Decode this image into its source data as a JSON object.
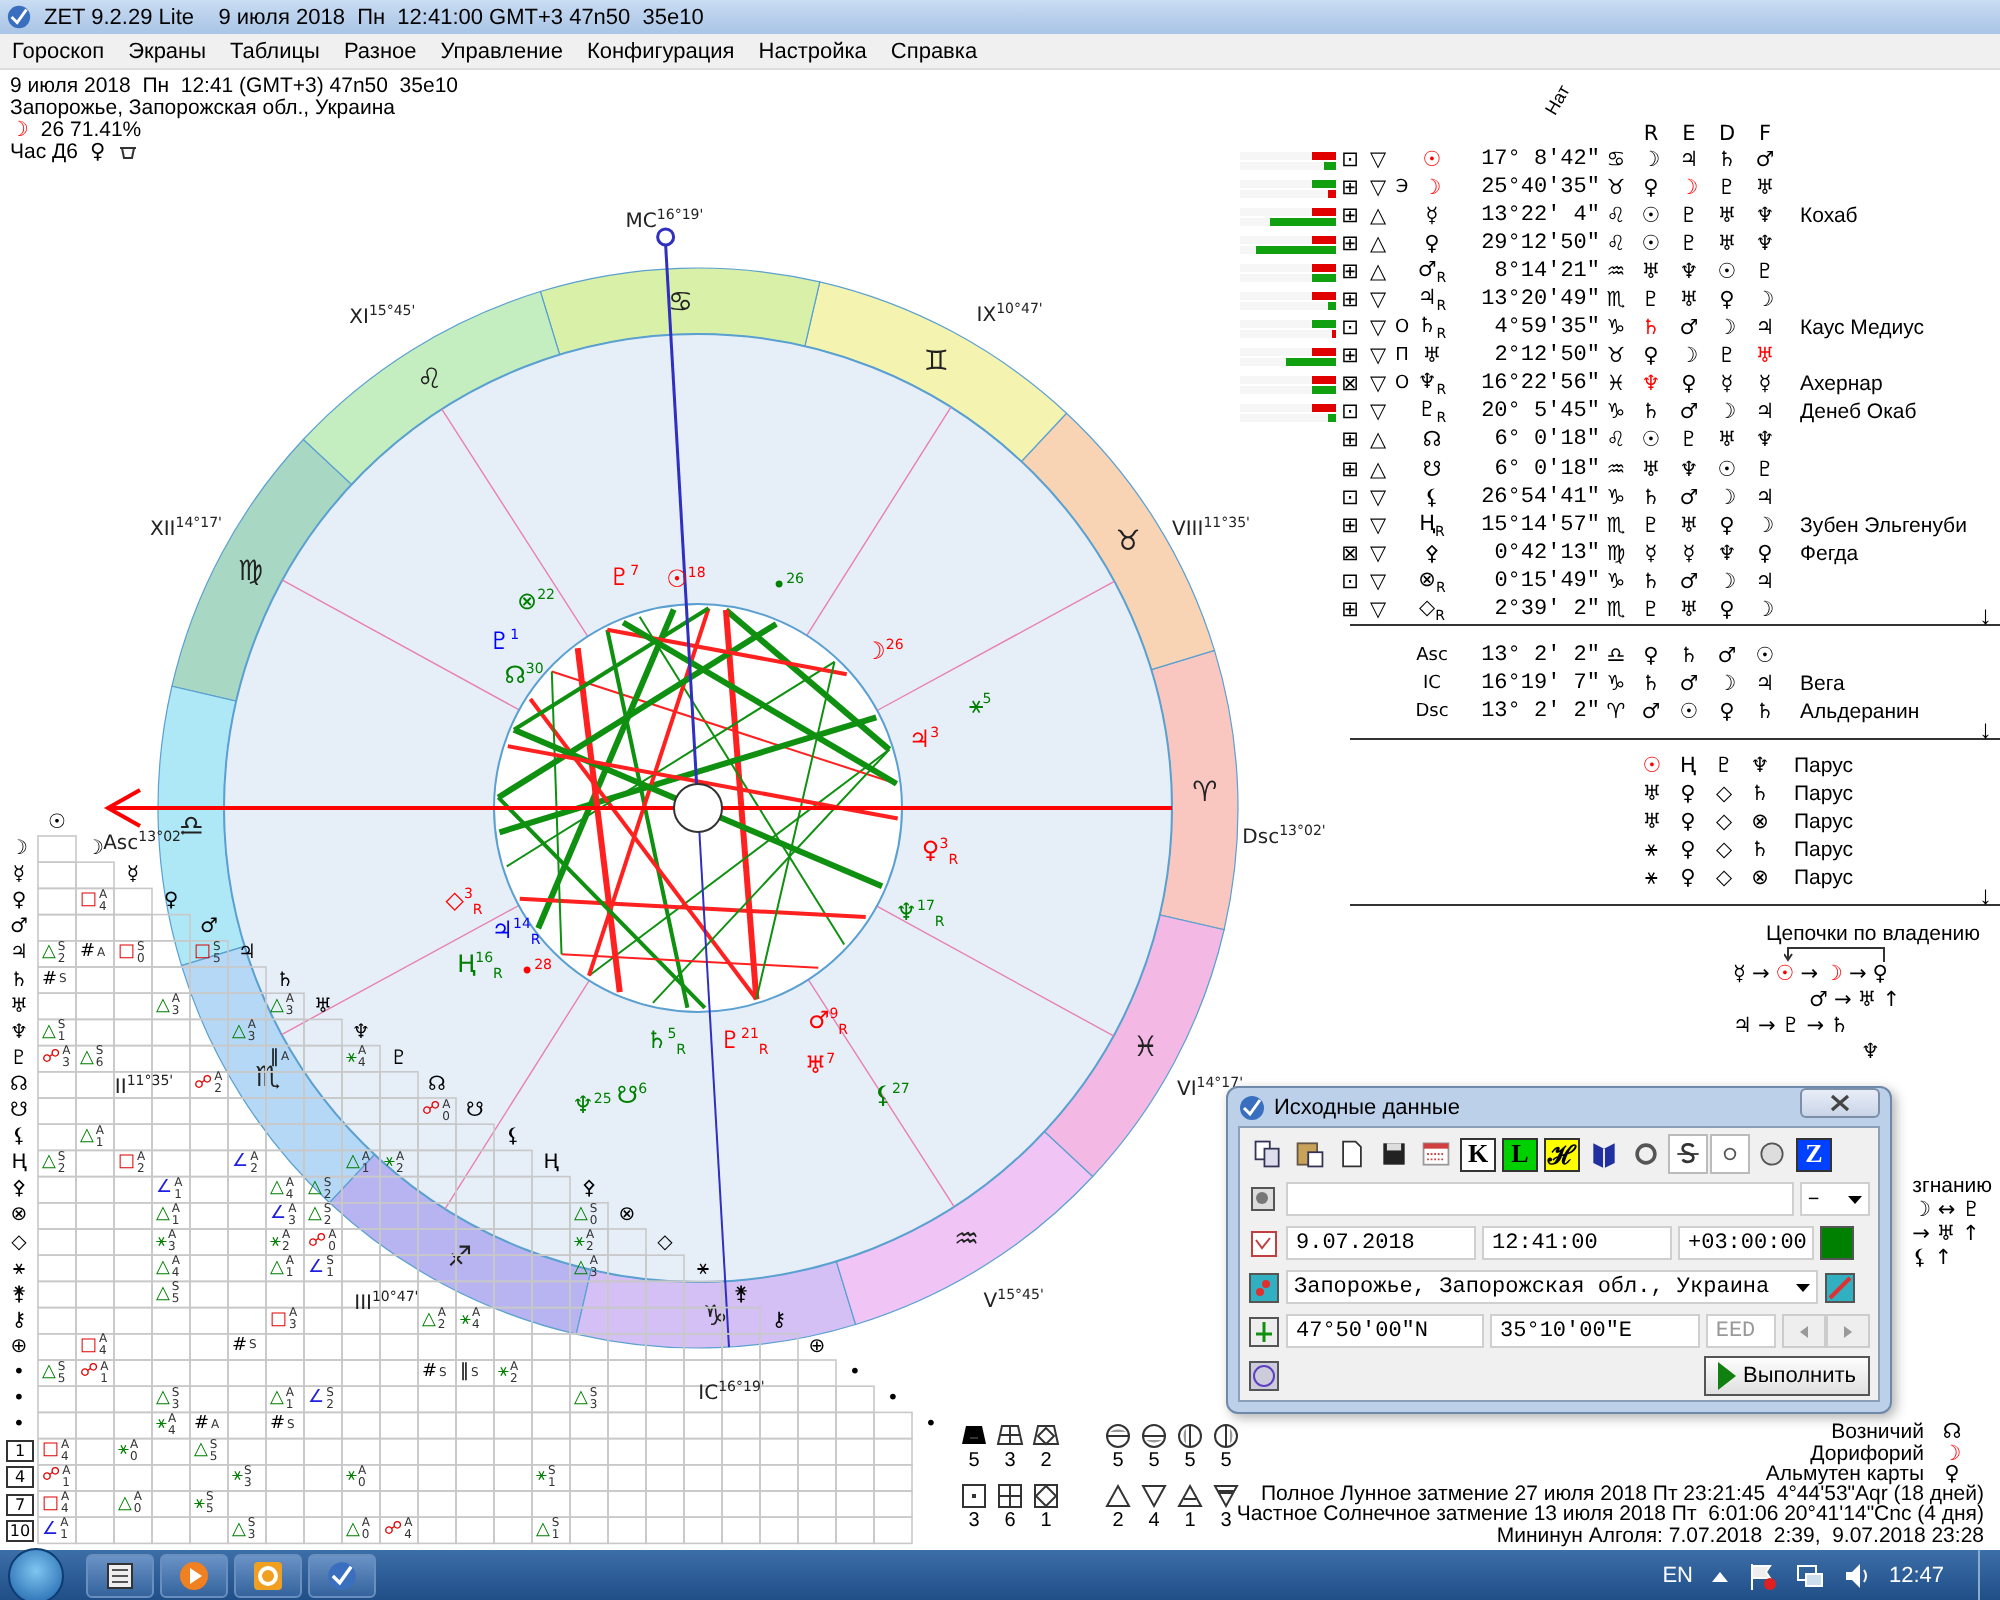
{
  "window": {
    "title": "ZET 9.2.29 Lite    9 июля 2018  Пн  12:41:00 GMT+3 47n50  35e10"
  },
  "menu": [
    "Гороскоп",
    "Экраны",
    "Таблицы",
    "Разное",
    "Управление",
    "Конфигурация",
    "Настройка",
    "Справка"
  ],
  "info": {
    "line1": "9 июля 2018  Пн  12:41 (GMT+3) 47n50  35e10",
    "place": "Запорожье, Запорожская обл., Украина",
    "moon_glyph": "☽",
    "moon": "26 71.41%",
    "hour": "Час Д6",
    "hour_glyph": "♀"
  },
  "wheel": {
    "signs": [
      "♈",
      "♉",
      "♊",
      "♋",
      "♌",
      "♍",
      "♎",
      "♏",
      "♐",
      "♑",
      "♒",
      "♓"
    ],
    "houses": [
      {
        "label": "Asc$^{13°02'}$"
      },
      {
        "label": "II$^{11°35'}$"
      },
      {
        "label": "III$^{10°47'}$"
      },
      {
        "label": "IC$^{16°19'}$"
      },
      {
        "label": "V$^{15°45'}$"
      },
      {
        "label": "VI$^{14°17'}$"
      },
      {
        "label": "Dsc$^{13°02'}$"
      },
      {
        "label": "VIII$^{11°35'}$"
      },
      {
        "label": "IX$^{10°47'}$"
      },
      {
        "label": "MC$^{16°19'}$"
      },
      {
        "label": "XI$^{15°45'}$"
      },
      {
        "label": "XII$^{14°17'}$"
      }
    ],
    "planets": [
      {
        "label": "☉$^{18}$",
        "color": "#ff0000"
      },
      {
        "label": "•$^{26}$",
        "color": "#008000"
      },
      {
        "label": "☽$^{26}$",
        "color": "#ff0000"
      },
      {
        "label": "⚹$^{5}$",
        "color": "#008000"
      },
      {
        "label": "♃$^{3}$",
        "color": "#ff0000"
      },
      {
        "label": "♀$^{3}$$_{R}$",
        "color": "#ff0000"
      },
      {
        "label": "♆$^{17}$$_{R}$",
        "color": "#008000"
      },
      {
        "label": "♂$^{9}$$_{R}$",
        "color": "#ff0000"
      },
      {
        "label": "♅$^{7}$",
        "color": "#ff0000"
      },
      {
        "label": "⚸$^{27}$",
        "color": "#008000"
      },
      {
        "label": "♄$^{5}$$_{R}$",
        "color": "#008000"
      },
      {
        "label": "♇$^{21}$$_{R}$",
        "color": "#ff0000"
      },
      {
        "label": "☋$^{6}$",
        "color": "#008000"
      },
      {
        "label": "♆$^{25}$",
        "color": "#008000"
      },
      {
        "label": "◇$^{3}$$_{R}$",
        "color": "#ff0000"
      },
      {
        "label": "♃$^{14}$$_{R}$",
        "color": "#0000ff"
      },
      {
        "label": "Ⱨ$^{16}$$_{R}$",
        "color": "#008000"
      },
      {
        "label": "•$^{28}$",
        "color": "#ff0000"
      },
      {
        "label": "♇$^{1}$",
        "color": "#0000ff"
      },
      {
        "label": "⊗$^{22}$",
        "color": "#008000"
      },
      {
        "label": "♇$^{7}$",
        "color": "#ff0000"
      },
      {
        "label": "☊$^{30}$",
        "color": "#008000"
      }
    ]
  },
  "aspect_grid": {
    "col_headers": [
      "☉",
      "☽",
      "☿",
      "♀",
      "♂",
      "♃",
      "♄",
      "♅",
      "♆",
      "♇",
      "☊",
      "☋",
      "⚸",
      "Ⱨ",
      "⚴",
      "⊗",
      "◇",
      "⚹",
      "⚵",
      "⚷",
      "⊕",
      "•",
      "•",
      "•"
    ],
    "rows": [
      {
        "label": "☽",
        "kind": "planet",
        "cells": []
      },
      {
        "label": "☿",
        "kind": "planet",
        "cells": []
      },
      {
        "label": "♀",
        "kind": "planet",
        "cells": [
          null,
          {
            "a": "□",
            "n": "A4",
            "kind": "square"
          }
        ]
      },
      {
        "label": "♂",
        "kind": "planet",
        "cells": []
      },
      {
        "label": "♃",
        "kind": "planet",
        "cells": [
          {
            "a": "△",
            "n": "S2",
            "kind": "trine"
          },
          {
            "a": "#",
            "n": "A",
            "kind": "parallel"
          },
          {
            "a": "□",
            "n": "S0",
            "kind": "square"
          },
          null,
          {
            "a": "□",
            "n": "S5",
            "kind": "square"
          }
        ]
      },
      {
        "label": "♄",
        "kind": "planet",
        "cells": [
          {
            "a": "#",
            "n": "S",
            "kind": "parallel"
          }
        ]
      },
      {
        "label": "♅",
        "kind": "planet",
        "cells": [
          null,
          null,
          null,
          {
            "a": "△",
            "n": "A3",
            "kind": "trine"
          },
          null,
          null,
          {
            "a": "△",
            "n": "A3",
            "kind": "trine"
          }
        ]
      },
      {
        "label": "♆",
        "kind": "planet",
        "cells": [
          {
            "a": "△",
            "n": "S1",
            "kind": "trine"
          },
          null,
          null,
          null,
          null,
          {
            "a": "△",
            "n": "A3",
            "kind": "trine"
          }
        ]
      },
      {
        "label": "♇",
        "kind": "planet",
        "cells": [
          {
            "a": "☍",
            "n": "A3",
            "kind": "opposition"
          },
          {
            "a": "△",
            "n": "S6",
            "kind": "trine"
          },
          null,
          null,
          null,
          null,
          {
            "a": "‖",
            "n": "A",
            "kind": "parallel"
          },
          null,
          {
            "a": "⚹",
            "n": "A4",
            "kind": "sextile"
          }
        ]
      },
      {
        "label": "☊",
        "kind": "planet",
        "cells": [
          null,
          null,
          null,
          null,
          {
            "a": "☍",
            "n": "A2",
            "kind": "opposition"
          }
        ]
      },
      {
        "label": "☋",
        "kind": "planet",
        "cells": [
          null,
          null,
          null,
          null,
          null,
          null,
          null,
          null,
          null,
          null,
          {
            "a": "☍",
            "n": "A0",
            "kind": "opposition"
          }
        ]
      },
      {
        "label": "⚸",
        "kind": "planet",
        "cells": [
          null,
          {
            "a": "△",
            "n": "A1",
            "kind": "trine"
          }
        ]
      },
      {
        "label": "Ⱨ",
        "kind": "planet",
        "cells": [
          {
            "a": "△",
            "n": "S2",
            "kind": "trine"
          },
          null,
          {
            "a": "□",
            "n": "A2",
            "kind": "square"
          },
          null,
          null,
          {
            "a": "∠",
            "n": "A2",
            "kind": "minor"
          },
          null,
          null,
          {
            "a": "△",
            "n": "A1",
            "kind": "trine"
          },
          {
            "a": "⚹",
            "n": "A2",
            "kind": "sextile"
          }
        ]
      },
      {
        "label": "⚴",
        "kind": "planet",
        "cells": [
          null,
          null,
          null,
          {
            "a": "∠",
            "n": "A1",
            "kind": "minor"
          },
          null,
          null,
          {
            "a": "△",
            "n": "A4",
            "kind": "trine"
          },
          {
            "a": "△",
            "n": "S2",
            "kind": "trine"
          }
        ]
      },
      {
        "label": "⊗",
        "kind": "planet",
        "cells": [
          null,
          null,
          null,
          {
            "a": "△",
            "n": "A1",
            "kind": "trine"
          },
          null,
          null,
          {
            "a": "∠",
            "n": "A3",
            "kind": "minor"
          },
          {
            "a": "△",
            "n": "S2",
            "kind": "trine"
          },
          null,
          null,
          null,
          null,
          null,
          null,
          {
            "a": "△",
            "n": "S0",
            "kind": "trine"
          }
        ]
      },
      {
        "label": "◇",
        "kind": "planet",
        "cells": [
          null,
          null,
          null,
          {
            "a": "⚹",
            "n": "A3",
            "kind": "sextile"
          },
          null,
          null,
          {
            "a": "⚹",
            "n": "A2",
            "kind": "sextile"
          },
          {
            "a": "☍",
            "n": "A0",
            "kind": "opposition"
          },
          null,
          null,
          null,
          null,
          null,
          null,
          {
            "a": "⚹",
            "n": "A2",
            "kind": "sextile"
          }
        ]
      },
      {
        "label": "⚹",
        "kind": "planet",
        "cells": [
          null,
          null,
          null,
          {
            "a": "△",
            "n": "A4",
            "kind": "trine"
          },
          null,
          null,
          {
            "a": "△",
            "n": "A1",
            "kind": "trine"
          },
          {
            "a": "∠",
            "n": "S1",
            "kind": "minor"
          },
          null,
          null,
          null,
          null,
          null,
          null,
          {
            "a": "△",
            "n": "A3",
            "kind": "trine"
          }
        ]
      },
      {
        "label": "⚵",
        "kind": "planet",
        "cells": [
          null,
          null,
          null,
          {
            "a": "△",
            "n": "S5",
            "kind": "trine"
          }
        ]
      },
      {
        "label": "⚷",
        "kind": "planet",
        "cells": [
          null,
          null,
          null,
          null,
          null,
          null,
          {
            "a": "□",
            "n": "A3",
            "kind": "square"
          },
          null,
          null,
          null,
          {
            "a": "△",
            "n": "A2",
            "kind": "trine"
          },
          {
            "a": "⚹",
            "n": "A4",
            "kind": "sextile"
          }
        ]
      },
      {
        "label": "⊕",
        "kind": "planet",
        "cells": [
          null,
          {
            "a": "□",
            "n": "A4",
            "kind": "square"
          },
          null,
          null,
          null,
          {
            "a": "#",
            "n": "S",
            "kind": "parallel"
          }
        ]
      },
      {
        "label": "•",
        "kind": "planet",
        "cells": [
          {
            "a": "△",
            "n": "S5",
            "kind": "trine"
          },
          {
            "a": "☍",
            "n": "A1",
            "kind": "opposition"
          },
          null,
          null,
          null,
          null,
          null,
          null,
          null,
          null,
          {
            "a": "#",
            "n": "S",
            "kind": "parallel"
          },
          {
            "a": "‖",
            "n": "S",
            "kind": "parallel"
          },
          {
            "a": "⚹",
            "n": "A2",
            "kind": "sextile"
          }
        ]
      },
      {
        "label": "•",
        "kind": "planet",
        "cells": [
          null,
          null,
          null,
          {
            "a": "△",
            "n": "S3",
            "kind": "trine"
          },
          null,
          null,
          {
            "a": "△",
            "n": "A1",
            "kind": "trine"
          },
          {
            "a": "∠",
            "n": "S2",
            "kind": "minor"
          },
          null,
          null,
          null,
          null,
          null,
          null,
          {
            "a": "△",
            "n": "S3",
            "kind": "trine"
          }
        ]
      },
      {
        "label": "•",
        "kind": "planet",
        "cells": [
          null,
          null,
          null,
          {
            "a": "⚹",
            "n": "A4",
            "kind": "sextile"
          },
          {
            "a": "#",
            "n": "A",
            "kind": "parallel"
          },
          null,
          {
            "a": "#",
            "n": "S",
            "kind": "parallel"
          }
        ]
      },
      {
        "label": "1",
        "kind": "house",
        "cells": [
          {
            "a": "□",
            "n": "A4",
            "kind": "square"
          },
          null,
          {
            "a": "⚹",
            "n": "A0",
            "kind": "sextile"
          },
          null,
          {
            "a": "△",
            "n": "S5",
            "kind": "trine"
          }
        ]
      },
      {
        "label": "4",
        "kind": "house",
        "cells": [
          {
            "a": "☍",
            "n": "A1",
            "kind": "opposition"
          },
          null,
          null,
          null,
          null,
          {
            "a": "⚹",
            "n": "S3",
            "kind": "sextile"
          },
          null,
          null,
          {
            "a": "⚹",
            "n": "A0",
            "kind": "sextile"
          },
          null,
          null,
          null,
          null,
          {
            "a": "⚹",
            "n": "S1",
            "kind": "sextile"
          }
        ]
      },
      {
        "label": "7",
        "kind": "house",
        "cells": [
          {
            "a": "□",
            "n": "A4",
            "kind": "square"
          },
          null,
          {
            "a": "△",
            "n": "A0",
            "kind": "trine"
          },
          null,
          {
            "a": "⚹",
            "n": "S5",
            "kind": "sextile"
          }
        ]
      },
      {
        "label": "10",
        "kind": "house",
        "cells": [
          {
            "a": "∠",
            "n": "A1",
            "kind": "minor"
          },
          null,
          null,
          null,
          null,
          {
            "a": "△",
            "n": "S3",
            "kind": "trine"
          },
          null,
          null,
          {
            "a": "△",
            "n": "A0",
            "kind": "trine"
          },
          {
            "a": "☍",
            "n": "A4",
            "kind": "opposition"
          },
          null,
          null,
          null,
          {
            "a": "△",
            "n": "S1",
            "kind": "trine"
          }
        ]
      }
    ]
  },
  "stats": {
    "top_left": [
      {
        "kind": "cup",
        "value": "5"
      },
      {
        "kind": "crosscup",
        "value": "3"
      },
      {
        "kind": "diamondcup",
        "value": "2"
      }
    ],
    "bottom_left": [
      {
        "kind": "dotbox",
        "value": "3"
      },
      {
        "kind": "crossbox",
        "value": "6"
      },
      {
        "kind": "diamondbox",
        "value": "1"
      }
    ],
    "top_right": [
      {
        "kind": "circleup",
        "value": "5"
      },
      {
        "kind": "circledown",
        "value": "5"
      },
      {
        "kind": "circleleft",
        "value": "5"
      },
      {
        "kind": "circleright",
        "value": "5"
      }
    ],
    "bottom_right": [
      {
        "kind": "triup",
        "value": "2"
      },
      {
        "kind": "tridown",
        "value": "4"
      },
      {
        "kind": "triupbar",
        "value": "1"
      },
      {
        "kind": "tridownfilled",
        "value": "3"
      }
    ]
  },
  "table": {
    "header": "Нат",
    "columns": [
      "R",
      "E",
      "D",
      "F"
    ],
    "more": "↓",
    "rows": [
      {
        "bars": [
          {
            "color": "#e00000",
            "level": 0.25
          },
          {
            "color": "#10a010",
            "level": 0.125
          }
        ],
        "box": "⊡",
        "tri": "▽",
        "planet": "☉",
        "highlighted": true,
        "pos": "17° 8'42\"",
        "sign": "♋",
        "rulers": [
          {
            "g": "☽",
            "highlighted": false
          },
          {
            "g": "♃",
            "highlighted": false
          },
          {
            "g": "♄",
            "highlighted": false
          },
          {
            "g": "♂",
            "highlighted": false
          }
        ]
      },
      {
        "bars": [
          {
            "color": "#10a010",
            "level": 0.25
          },
          {
            "color": "#e00000",
            "level": 0.08
          }
        ],
        "box": "⊞",
        "tri": "▽",
        "mark": "Э",
        "planet": "☽",
        "highlighted": true,
        "pos": "25°40'35\"",
        "sign": "♉",
        "rulers": [
          {
            "g": "♀",
            "highlighted": false
          },
          {
            "g": "☽",
            "highlighted": true
          },
          {
            "g": "♇",
            "highlighted": false
          },
          {
            "g": "♅",
            "highlighted": false
          }
        ]
      },
      {
        "bars": [
          {
            "color": "#e00000",
            "level": 0.25
          },
          {
            "color": "#10a010",
            "level": 0.69
          }
        ],
        "box": "⊞",
        "tri": "△",
        "planet": "☿",
        "highlighted": false,
        "pos": "13°22' 4\"",
        "sign": "♌",
        "rulers": [
          {
            "g": "☉",
            "highlighted": false
          },
          {
            "g": "♇",
            "highlighted": false
          },
          {
            "g": "♅",
            "highlighted": false
          },
          {
            "g": "♆",
            "highlighted": false
          }
        ],
        "star": "Кохаб"
      },
      {
        "bars": [
          {
            "color": "#e00000",
            "level": 0.25
          },
          {
            "color": "#10a010",
            "level": 0.83
          }
        ],
        "box": "⊞",
        "tri": "△",
        "planet": "♀",
        "highlighted": false,
        "pos": "29°12'50\"",
        "sign": "♌",
        "rulers": [
          {
            "g": "☉",
            "highlighted": false
          },
          {
            "g": "♇",
            "highlighted": false
          },
          {
            "g": "♅",
            "highlighted": false
          },
          {
            "g": "♆",
            "highlighted": false
          }
        ]
      },
      {
        "bars": [
          {
            "color": "#e00000",
            "level": 0.25
          },
          {
            "color": "#10a010",
            "level": 0.25
          }
        ],
        "box": "⊞",
        "tri": "△",
        "planet": "♂$_{R}$",
        "highlighted": false,
        "pos": "8°14'21\"",
        "sign": "♒",
        "rulers": [
          {
            "g": "♅",
            "highlighted": false
          },
          {
            "g": "♆",
            "highlighted": false
          },
          {
            "g": "☉",
            "highlighted": false
          },
          {
            "g": "♇",
            "highlighted": false
          }
        ]
      },
      {
        "bars": [
          {
            "color": "#e00000",
            "level": 0.25
          },
          {
            "color": "#10a010",
            "level": 0.08
          }
        ],
        "box": "⊞",
        "tri": "▽",
        "planet": "♃$_{R}$",
        "highlighted": false,
        "pos": "13°20'49\"",
        "sign": "♏",
        "rulers": [
          {
            "g": "♇",
            "highlighted": false
          },
          {
            "g": "♅",
            "highlighted": false
          },
          {
            "g": "♀",
            "highlighted": false
          },
          {
            "g": "☽",
            "highlighted": false
          }
        ]
      },
      {
        "bars": [
          {
            "color": "#10a010",
            "level": 0.25
          },
          {
            "color": "#e00000",
            "level": 0.04
          }
        ],
        "box": "⊡",
        "tri": "▽",
        "mark": "О",
        "planet": "♄$_{R}$",
        "highlighted": false,
        "pos": "4°59'35\"",
        "sign": "♑",
        "rulers": [
          {
            "g": "♄",
            "highlighted": true
          },
          {
            "g": "♂",
            "highlighted": false
          },
          {
            "g": "☽",
            "highlighted": false
          },
          {
            "g": "♃",
            "highlighted": false
          }
        ],
        "star": "Каус Медиус"
      },
      {
        "bars": [
          {
            "color": "#e00000",
            "level": 0.25
          },
          {
            "color": "#10a010",
            "level": 0.52
          }
        ],
        "box": "⊞",
        "tri": "▽",
        "mark": "П",
        "planet": "♅",
        "highlighted": false,
        "pos": "2°12'50\"",
        "sign": "♉",
        "rulers": [
          {
            "g": "♀",
            "highlighted": false
          },
          {
            "g": "☽",
            "highlighted": false
          },
          {
            "g": "♇",
            "highlighted": false
          },
          {
            "g": "♅",
            "highlighted": true
          }
        ]
      },
      {
        "bars": [
          {
            "color": "#e00000",
            "level": 0.25
          },
          {
            "color": "#10a010",
            "level": 0.25
          }
        ],
        "box": "⊠",
        "tri": "▽",
        "mark": "О",
        "planet": "♆$_{R}$",
        "highlighted": false,
        "pos": "16°22'56\"",
        "sign": "♓",
        "rulers": [
          {
            "g": "♆",
            "highlighted": true
          },
          {
            "g": "♀",
            "highlighted": false
          },
          {
            "g": "☿",
            "highlighted": false
          },
          {
            "g": "☿",
            "highlighted": false
          }
        ],
        "star": "Ахернар"
      },
      {
        "bars": [
          {
            "color": "#e00000",
            "level": 0.25
          },
          {
            "color": "#10a010",
            "level": 0.08
          }
        ],
        "box": "⊡",
        "tri": "▽",
        "planet": "♇$_{R}$",
        "highlighted": false,
        "pos": "20° 5'45\"",
        "sign": "♑",
        "rulers": [
          {
            "g": "♄",
            "highlighted": false
          },
          {
            "g": "♂",
            "highlighted": false
          },
          {
            "g": "☽",
            "highlighted": false
          },
          {
            "g": "♃",
            "highlighted": false
          }
        ],
        "star": "Денеб Окаб"
      },
      {
        "bars": [],
        "box": "⊞",
        "tri": "△",
        "planet": "☊",
        "highlighted": false,
        "pos": "6° 0'18\"",
        "sign": "♌",
        "rulers": [
          {
            "g": "☉",
            "highlighted": false
          },
          {
            "g": "♇",
            "highlighted": false
          },
          {
            "g": "♅",
            "highlighted": false
          },
          {
            "g": "♆",
            "highlighted": false
          }
        ]
      },
      {
        "bars": [],
        "box": "⊞",
        "tri": "△",
        "planet": "☋",
        "highlighted": false,
        "pos": "6° 0'18\"",
        "sign": "♒",
        "rulers": [
          {
            "g": "♅",
            "highlighted": false
          },
          {
            "g": "♆",
            "highlighted": false
          },
          {
            "g": "☉",
            "highlighted": false
          },
          {
            "g": "♇",
            "highlighted": false
          }
        ]
      },
      {
        "bars": [],
        "box": "⊡",
        "tri": "▽",
        "planet": "⚸",
        "highlighted": false,
        "pos": "26°54'41\"",
        "sign": "♑",
        "rulers": [
          {
            "g": "♄",
            "highlighted": false
          },
          {
            "g": "♂",
            "highlighted": false
          },
          {
            "g": "☽",
            "highlighted": false
          },
          {
            "g": "♃",
            "highlighted": false
          }
        ]
      },
      {
        "bars": [],
        "box": "⊞",
        "tri": "▽",
        "planet": "Ⱨ$_{R}$",
        "highlighted": false,
        "pos": "15°14'57\"",
        "sign": "♏",
        "rulers": [
          {
            "g": "♇",
            "highlighted": false
          },
          {
            "g": "♅",
            "highlighted": false
          },
          {
            "g": "♀",
            "highlighted": false
          },
          {
            "g": "☽",
            "highlighted": false
          }
        ],
        "star": "Зубен Эльгенуби"
      },
      {
        "bars": [],
        "box": "⊠",
        "tri": "▽",
        "planet": "⚴",
        "highlighted": false,
        "pos": "0°42'13\"",
        "sign": "♍",
        "rulers": [
          {
            "g": "☿",
            "highlighted": false
          },
          {
            "g": "☿",
            "highlighted": false
          },
          {
            "g": "♆",
            "highlighted": false
          },
          {
            "g": "♀",
            "highlighted": false
          }
        ],
        "star": "Фегда"
      },
      {
        "bars": [],
        "box": "⊡",
        "tri": "▽",
        "planet": "⊗$_{R}$",
        "highlighted": false,
        "pos": "0°15'49\"",
        "sign": "♑",
        "rulers": [
          {
            "g": "♄",
            "highlighted": false
          },
          {
            "g": "♂",
            "highlighted": false
          },
          {
            "g": "☽",
            "highlighted": false
          },
          {
            "g": "♃",
            "highlighted": false
          }
        ]
      },
      {
        "bars": [],
        "box": "⊞",
        "tri": "▽",
        "planet": "◇$_{R}$",
        "highlighted": false,
        "pos": "2°39' 2\"",
        "sign": "♏",
        "rulers": [
          {
            "g": "♇",
            "highlighted": false
          },
          {
            "g": "♅",
            "highlighted": false
          },
          {
            "g": "♀",
            "highlighted": false
          },
          {
            "g": "☽",
            "highlighted": false
          }
        ]
      }
    ]
  },
  "angles": {
    "more": "↓",
    "rows": [
      {
        "label": "Asc",
        "pos": "13° 2' 2\"",
        "sign": "♎",
        "rulers": [
          "♀",
          "♄",
          "♂",
          "☉"
        ]
      },
      {
        "label": "IC",
        "pos": "16°19' 7\"",
        "sign": "♑",
        "rulers": [
          "♄",
          "♂",
          "☽",
          "♃"
        ],
        "star": "Вега"
      },
      {
        "label": "Dsc",
        "pos": "13° 2' 2\"",
        "sign": "♈",
        "rulers": [
          "♂",
          "☉",
          "♀",
          "♄"
        ],
        "star": "Альдеранин"
      }
    ]
  },
  "configurations": {
    "more": "↓",
    "rows": [
      {
        "glyphs": [
          {
            "g": "☉",
            "highlighted": true
          },
          {
            "g": "Ⱨ",
            "highlighted": false
          },
          {
            "g": "♇",
            "highlighted": false
          },
          {
            "g": "♆",
            "highlighted": false
          }
        ],
        "name": "Парус"
      },
      {
        "glyphs": [
          {
            "g": "♅",
            "highlighted": false
          },
          {
            "g": "♀",
            "highlighted": false
          },
          {
            "g": "◇",
            "highlighted": false
          },
          {
            "g": "♄",
            "highlighted": false
          }
        ],
        "name": "Парус"
      },
      {
        "glyphs": [
          {
            "g": "♅",
            "highlighted": false
          },
          {
            "g": "♀",
            "highlighted": false
          },
          {
            "g": "◇",
            "highlighted": false
          },
          {
            "g": "⊗",
            "highlighted": false
          }
        ],
        "name": "Парус"
      },
      {
        "glyphs": [
          {
            "g": "⚹",
            "highlighted": false
          },
          {
            "g": "♀",
            "highlighted": false
          },
          {
            "g": "◇",
            "highlighted": false
          },
          {
            "g": "♄",
            "highlighted": false
          }
        ],
        "name": "Парус"
      },
      {
        "glyphs": [
          {
            "g": "⚹",
            "highlighted": false
          },
          {
            "g": "♀",
            "highlighted": false
          },
          {
            "g": "◇",
            "highlighted": false
          },
          {
            "g": "⊗",
            "highlighted": false
          }
        ],
        "name": "Парус"
      }
    ]
  },
  "chains": {
    "title": "Цепочки по владению",
    "lines": [
      [
        {
          "t": "☿",
          "highlighted": false
        },
        {
          "t": "→",
          "highlighted": false
        },
        {
          "t": "☉",
          "highlighted": true
        },
        {
          "t": "→",
          "highlighted": false
        },
        {
          "t": "☽",
          "highlighted": true
        },
        {
          "t": "→",
          "highlighted": false
        },
        {
          "t": "♀",
          "highlighted": false
        }
      ],
      [
        {
          "t": "♂",
          "highlighted": false
        },
        {
          "t": "→",
          "highlighted": false
        },
        {
          "t": "♅",
          "highlighted": false
        },
        {
          "t": "↑",
          "highlighted": false
        }
      ],
      [
        {
          "t": "♃",
          "highlighted": false
        },
        {
          "t": "→",
          "highlighted": false
        },
        {
          "t": "♇",
          "highlighted": false
        },
        {
          "t": "→",
          "highlighted": false
        },
        {
          "t": "♄",
          "highlighted": false
        }
      ],
      [
        {
          "t": "♆",
          "highlighted": false
        }
      ]
    ]
  },
  "exile_fragment": {
    "title": "згнанию",
    "lines": [
      "☽ ↔ ♇",
      "→ ♅ ↑",
      "⚸ ↑"
    ]
  },
  "notes": [
    {
      "label": "Возничий",
      "glyph": "☊",
      "highlighted": false
    },
    {
      "label": "Дорифорий",
      "glyph": "☽",
      "highlighted": true
    },
    {
      "label": "Альмутен карты",
      "glyph": "♀",
      "highlighted": false
    }
  ],
  "eclipses": [
    "Полное Лунное затмение 27 июля 2018 Пт 23:21:45  4°44'53\"Aqr (18 дней)",
    "Частное Солнечное затмение 13 июля 2018 Пт  6:01:06 20°41'14\"Cnc (4 дня)",
    "Мининун Алголя: 7.07.2018  2:39,  9.07.2018 23:28"
  ],
  "dialog": {
    "title": "Исходные данные",
    "toolbar": [
      {
        "kind": "copy",
        "pressed": false
      },
      {
        "kind": "paste",
        "pressed": false
      },
      {
        "kind": "new",
        "pressed": false
      },
      {
        "kind": "save",
        "pressed": false
      },
      {
        "kind": "calendar",
        "pressed": false
      },
      {
        "kind": "letter",
        "text": "K",
        "color": "#ffffff",
        "pressed": false
      },
      {
        "kind": "letter",
        "text": "L",
        "color": "#00d000",
        "pressed": false
      },
      {
        "kind": "letter",
        "text": "ℋ",
        "color": "#ffff00",
        "pressed": false
      },
      {
        "kind": "book",
        "pressed": false
      },
      {
        "kind": "ring",
        "pressed": false
      },
      {
        "kind": "strike",
        "pressed": true
      },
      {
        "kind": "dot",
        "pressed": true
      },
      {
        "kind": "circle",
        "pressed": false
      },
      {
        "kind": "letter",
        "text": "Z",
        "color": "#0040ff",
        "pressed": false
      }
    ],
    "select": "–",
    "date": "9.07.2018",
    "time": "12:41:00",
    "tz": "+03:00:00",
    "place": "Запорожье, Запорожская обл., Украина",
    "lat": "47°50'00\"N",
    "lon": "35°10'00\"E",
    "zone": {
      "value": "EED",
      "disabled": true
    },
    "run": "Выполнить"
  },
  "taskbar": {
    "lang": "EN",
    "clock": "12:47"
  }
}
